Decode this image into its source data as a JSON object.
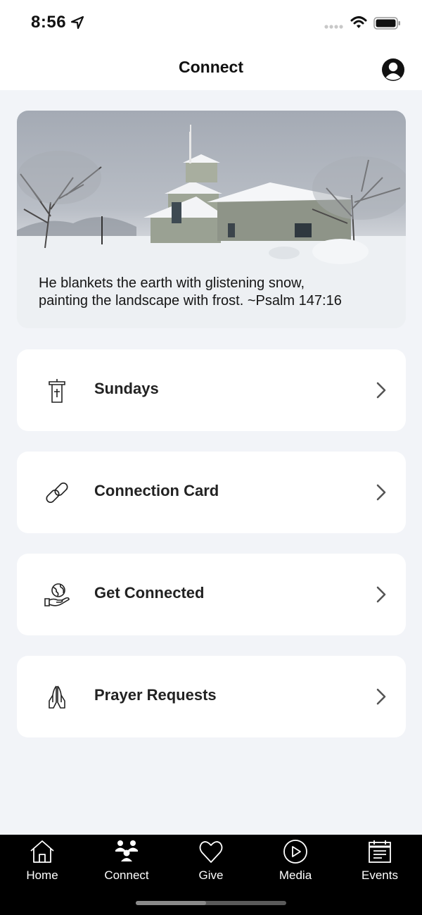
{
  "status_bar": {
    "time": "8:56"
  },
  "header": {
    "title": "Connect",
    "profile_icon": "person-circle-icon"
  },
  "hero": {
    "caption_line1": "He blankets the earth with glistening snow,",
    "caption_line2": "painting the landscape with frost. ~Psalm 147:16"
  },
  "menu": {
    "items": [
      {
        "label": "Sundays",
        "icon": "pulpit-icon"
      },
      {
        "label": "Connection Card",
        "icon": "link-icon"
      },
      {
        "label": "Get Connected",
        "icon": "globe-in-hand-icon"
      },
      {
        "label": "Prayer Requests",
        "icon": "praying-hands-icon"
      }
    ]
  },
  "tabs": [
    {
      "label": "Home",
      "icon": "home-icon"
    },
    {
      "label": "Connect",
      "icon": "people-icon",
      "active": true
    },
    {
      "label": "Give",
      "icon": "heart-icon"
    },
    {
      "label": "Media",
      "icon": "play-circle-icon"
    },
    {
      "label": "Events",
      "icon": "calendar-icon"
    }
  ]
}
